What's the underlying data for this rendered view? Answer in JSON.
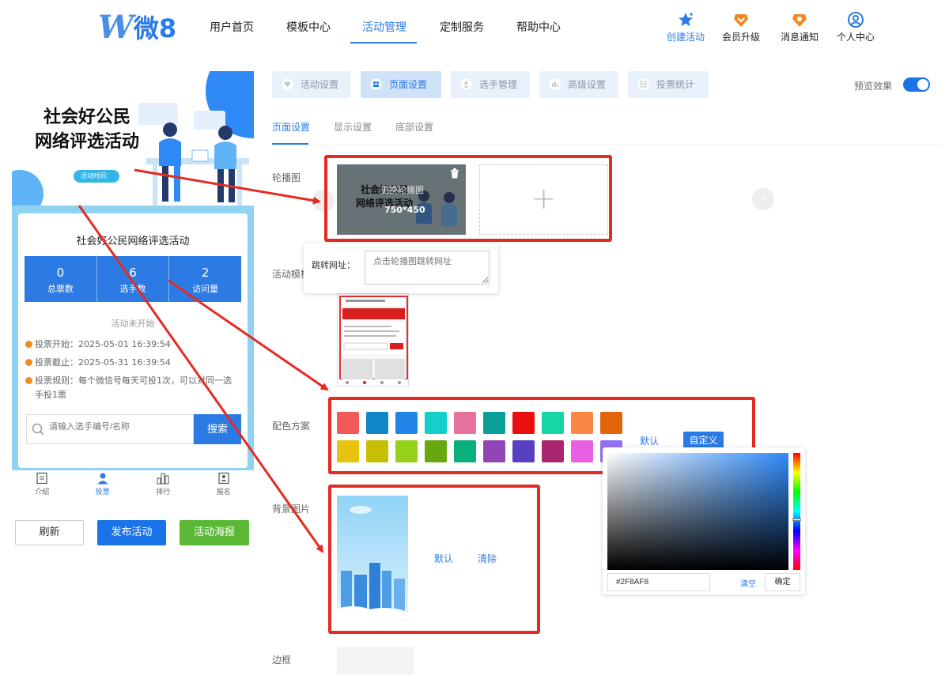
{
  "nav": {
    "logo_w": "W",
    "logo_text": "微8",
    "items": [
      "用户首页",
      "模板中心",
      "活动管理",
      "定制服务",
      "帮助中心"
    ],
    "active_index": 2,
    "utils": [
      "创建活动",
      "会员升级",
      "消息通知",
      "个人中心"
    ]
  },
  "preview": {
    "hero_title_line1": "社会好公民",
    "hero_title_line2": "网络评选活动",
    "hero_pill": "活动时间：xxxx",
    "card_title": "社会好公民网络评选活动",
    "stats": [
      {
        "value": "0",
        "label": "总票数"
      },
      {
        "value": "6",
        "label": "选手数"
      },
      {
        "value": "2",
        "label": "访问量"
      }
    ],
    "status": "活动未开始",
    "info": [
      "投票开始：2025-05-01 16:39:54",
      "投票截止：2025-05-31 16:39:54",
      "投票规则：每个微信号每天可投1次，可以对同一选手投1票"
    ],
    "search_placeholder": "请输入选手编号/名称",
    "search_button": "搜索",
    "tabs": [
      "介绍",
      "投票",
      "排行",
      "报名"
    ],
    "active_tab": 1,
    "buttons": {
      "refresh": "刷新",
      "publish": "发布活动",
      "poster": "活动海报"
    }
  },
  "settings": {
    "top_tabs": [
      "活动设置",
      "页面设置",
      "选手管理",
      "高级设置",
      "投票统计"
    ],
    "active_top_tab": 1,
    "preview_toggle_label": "预览效果",
    "preview_toggle_on": true,
    "sub_tabs": [
      "页面设置",
      "显示设置",
      "底部设置"
    ],
    "active_sub_tab": 0,
    "labels": {
      "carousel": "轮播图",
      "template": "活动模板",
      "theme": "配色方案",
      "background": "背景图片",
      "border": "边框"
    },
    "carousel": {
      "image_title_line1": "社会好公民",
      "image_title_line2": "网络评选活动",
      "hint": "更换轮播图",
      "size": "750*450",
      "add_symbol": "+"
    },
    "url_popup": {
      "label": "跳转网址：",
      "placeholder": "点击轮播图跳转网址"
    },
    "theme": {
      "colors_row1": [
        "#f25a5a",
        "#0e86c8",
        "#1f86e8",
        "#14d0cc",
        "#e8709c",
        "#0a9e98",
        "#e80f0f",
        "#16d6a4",
        "#fb8744",
        "#e2640a"
      ],
      "colors_row2": [
        "#e6c30e",
        "#c6bf05",
        "#95d11a",
        "#67a812",
        "#0ab07a",
        "#9146b6",
        "#5840c0",
        "#aa2770",
        "#ea60e2",
        "#9370f6"
      ],
      "default_label": "默认",
      "custom_label": "自定义"
    },
    "picker": {
      "hex": "#2F8AF8",
      "clear": "清空",
      "ok": "确定"
    },
    "background": {
      "default_label": "默认",
      "clear_label": "清除"
    }
  },
  "colors": {
    "primary": "#2c7be5",
    "annotation_red": "#e52a22",
    "poster_green": "#5bb936"
  }
}
